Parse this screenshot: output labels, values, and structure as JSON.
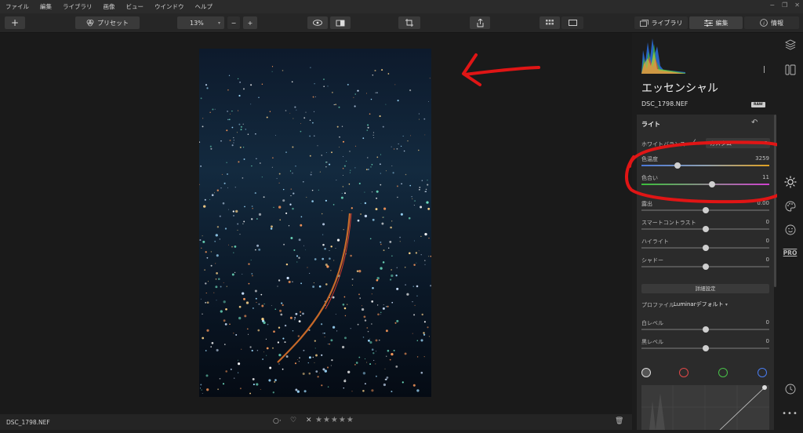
{
  "menu": [
    "ファイル",
    "編集",
    "ライブラリ",
    "画像",
    "ビュー",
    "ウインドウ",
    "ヘルプ"
  ],
  "toolbar": {
    "add_label": "+",
    "preset_label": "プリセット",
    "zoom_value": "13%",
    "zoom_minus": "−",
    "zoom_plus": "+"
  },
  "tabs": [
    {
      "label": "ライブラリ"
    },
    {
      "label": "編集"
    },
    {
      "label": "情報"
    }
  ],
  "panel": {
    "title": "エッセンシャル",
    "filename": "DSC_1798.NEF",
    "raw_badge": "RAW",
    "section_title": "ライト",
    "white_balance_label": "ホワイトバランス",
    "white_balance_value": "カスタム",
    "sliders": [
      {
        "label": "色温度",
        "value": "3259",
        "level": 0.28
      },
      {
        "label": "色合い",
        "value": "11",
        "level": 0.55
      },
      {
        "label": "露出",
        "value": "0.00",
        "level": 0.5
      },
      {
        "label": "スマートコントラスト",
        "value": "0",
        "level": 0.5
      },
      {
        "label": "ハイライト",
        "value": "0",
        "level": 0.5
      },
      {
        "label": "シャドー",
        "value": "0",
        "level": 0.5
      }
    ],
    "detail_button": "詳細設定",
    "profile_label": "プロファイル",
    "profile_value": "Luminarデフォルト",
    "levels": [
      {
        "label": "白レベル",
        "value": "0",
        "level": 0.5
      },
      {
        "label": "黒レベル",
        "value": "0",
        "level": 0.5
      }
    ],
    "curve_channels": [
      "#dddddd",
      "#e04848",
      "#48c048",
      "#4a7cf0"
    ]
  },
  "status": {
    "filename": "DSC_1798.NEF"
  },
  "rightstrip": {
    "pro_label": "PRO"
  },
  "colors": {
    "annotation": "#e01515",
    "accent_temp_start": "#4a78d8",
    "accent_temp_end": "#e0a020"
  }
}
